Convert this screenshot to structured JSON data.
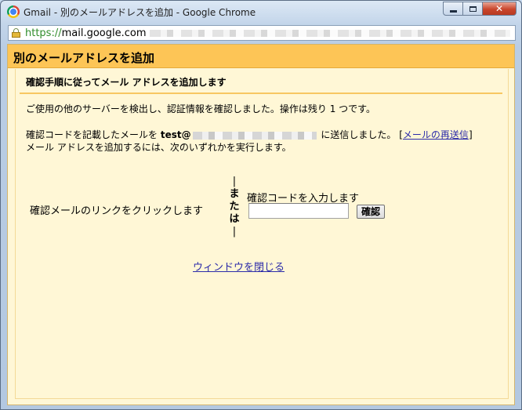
{
  "window": {
    "title": "Gmail - 別のメールアドレスを追加 - Google Chrome",
    "close_glyph": "✕"
  },
  "address_bar": {
    "scheme": "https://",
    "host": "mail.google.com"
  },
  "dialog": {
    "title": "別のメールアドレスを追加",
    "subheading": "確認手順に従ってメール アドレスを追加します",
    "status_text": "ご使用の他のサーバーを検出し、認証情報を確認しました。操作は残り 1 つです。",
    "sent_prefix": "確認コードを記載したメールを ",
    "email_visible": "test@",
    "sent_suffix": " に送信しました。 ",
    "resend_open": "[",
    "resend_link": "メールの再送信",
    "resend_close": "]",
    "instruction": "メール アドレスを追加するには、次のいずれかを実行します。",
    "option_link_text": "確認メールのリンクをクリックします",
    "or_chars": [
      "|",
      "ま",
      "た",
      "は",
      "|"
    ],
    "code_label": "確認コードを入力します",
    "code_value": "",
    "confirm_button": "確認",
    "close_window_link": "ウィンドウを閉じる"
  },
  "colors": {
    "header_bg": "#fdc556",
    "content_bg": "#fff7d6",
    "rule": "#f7c761",
    "link": "#2b2ba9",
    "https_green": "#2f8c2a"
  }
}
